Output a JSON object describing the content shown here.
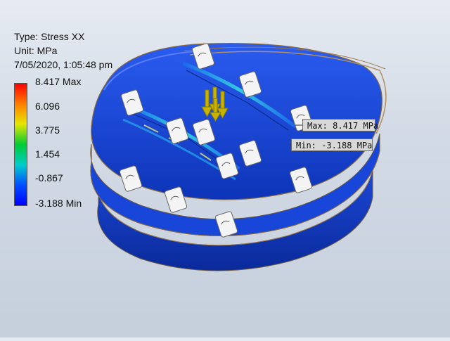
{
  "result": {
    "type_line": "Type: Stress XX",
    "unit_line": "Unit: MPa",
    "date_line": "7/05/2020, 1:05:48 pm"
  },
  "legend": {
    "labels": [
      "8.417 Max",
      "6.096",
      "3.775",
      "1.454",
      "-0.867",
      "-3.188 Min"
    ],
    "colors": [
      "#ff0000",
      "#ff8000",
      "#e6e600",
      "#00cc33",
      "#00cccc",
      "#0050ff",
      "#0000ff"
    ]
  },
  "probes": {
    "max": "Max: 8.417 MPa",
    "min": "Min: -3.188 MPa"
  },
  "colors": {
    "part_base": "#1a4ee6",
    "part_dark": "#0b2fb0",
    "part_highlight": "#2fd3e8",
    "outline": "#8a6a3c",
    "load_arrow": "#b8a400"
  }
}
